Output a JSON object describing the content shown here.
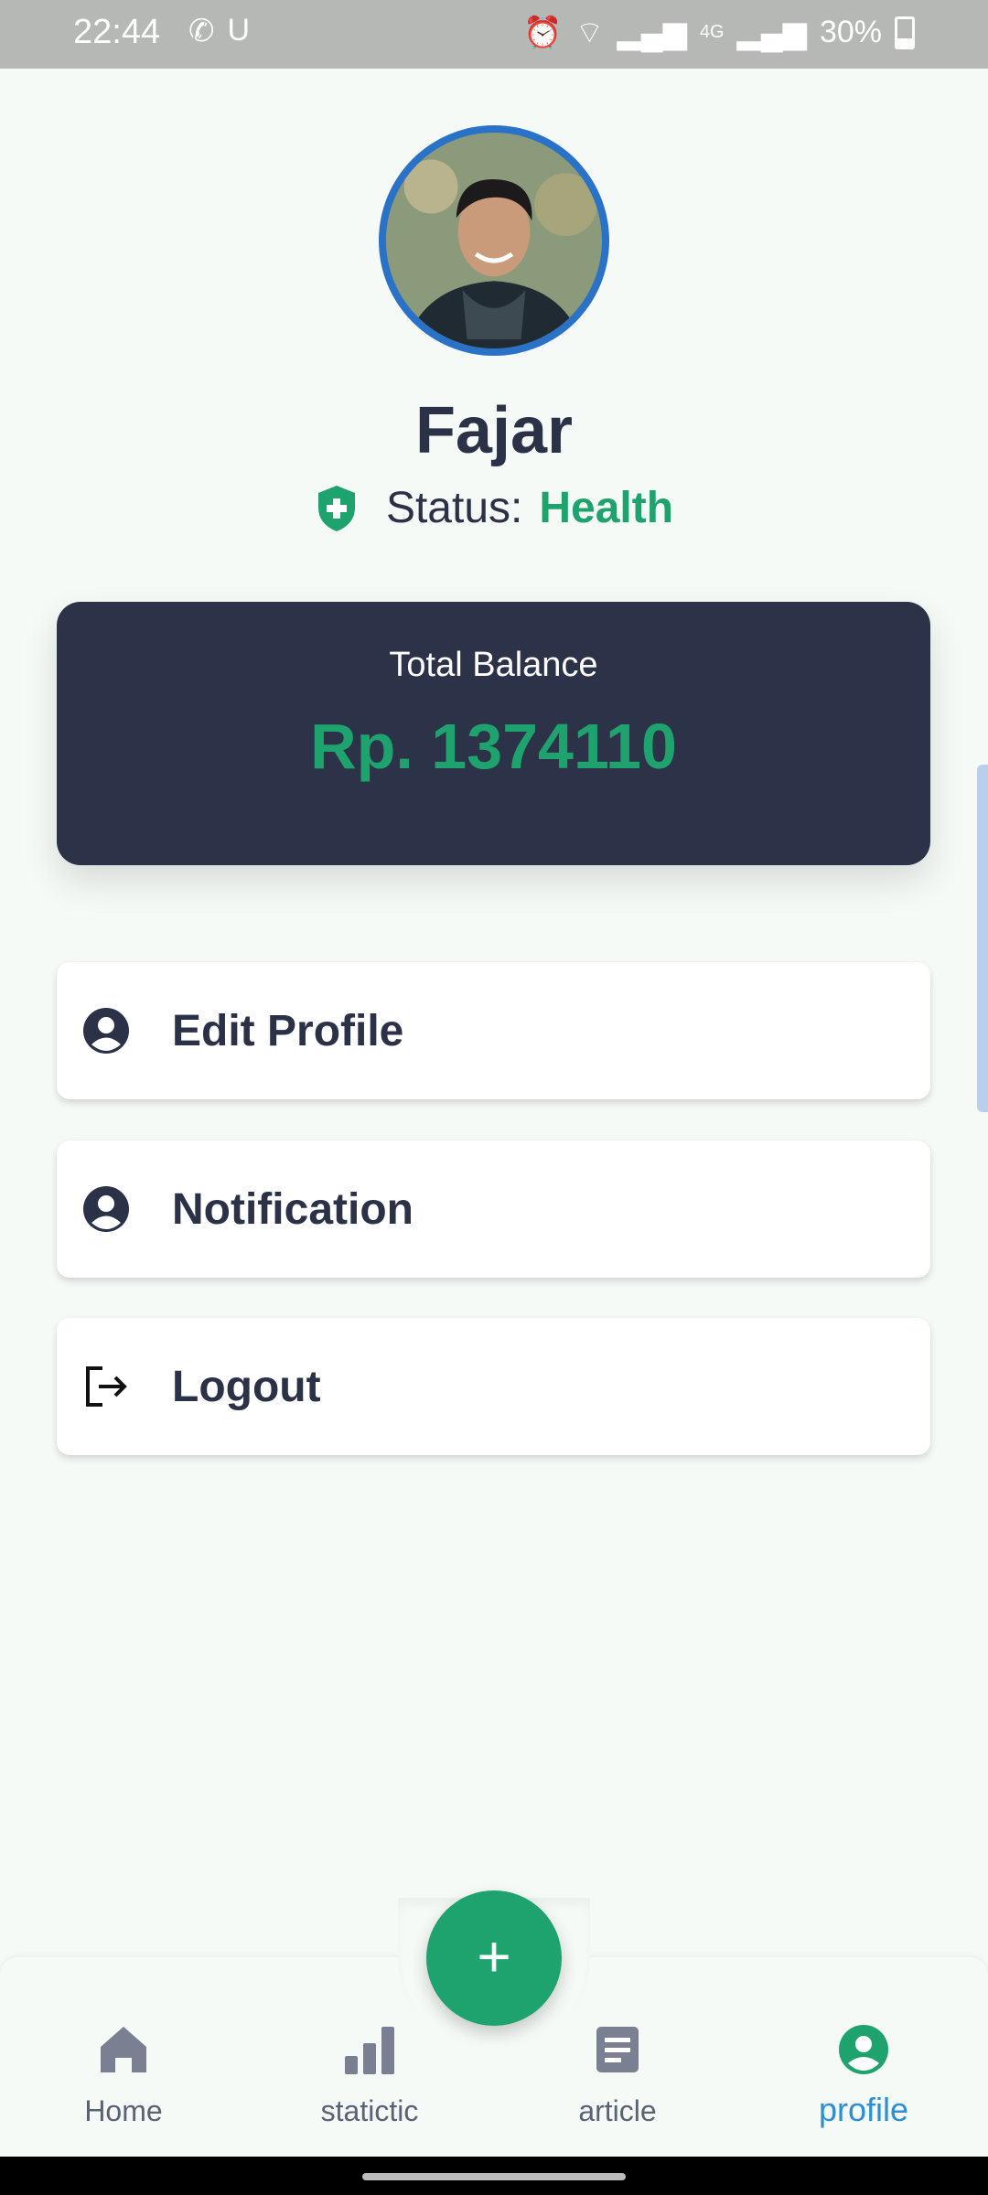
{
  "status_bar": {
    "time": "22:44",
    "battery": "30%",
    "network": "4G",
    "icons": [
      "whatsapp-icon",
      "u-icon",
      "alarm-icon",
      "wifi-icon",
      "signal-icon",
      "battery-icon"
    ]
  },
  "profile": {
    "name": "Fajar",
    "status_label": "Status:",
    "status_value": "Health",
    "avatar": "user-avatar-photo"
  },
  "balance": {
    "label": "Total Balance",
    "value": "Rp. 1374110"
  },
  "menu": [
    {
      "label": "Edit Profile",
      "icon": "user-circle-icon"
    },
    {
      "label": "Notification",
      "icon": "user-circle-icon"
    },
    {
      "label": "Logout",
      "icon": "logout-icon"
    }
  ],
  "fab": {
    "symbol": "+"
  },
  "bottom_nav": [
    {
      "label": "Home",
      "icon": "home-icon",
      "active": false
    },
    {
      "label": "statictic",
      "icon": "bar-chart-icon",
      "active": false
    },
    {
      "label": "article",
      "icon": "article-icon",
      "active": false
    },
    {
      "label": "profile",
      "icon": "user-circle-icon",
      "active": true
    }
  ],
  "colors": {
    "accent_green": "#1fa36e",
    "dark_navy": "#2c3248",
    "active_blue": "#2a8fd4",
    "background": "#f5faf7"
  }
}
